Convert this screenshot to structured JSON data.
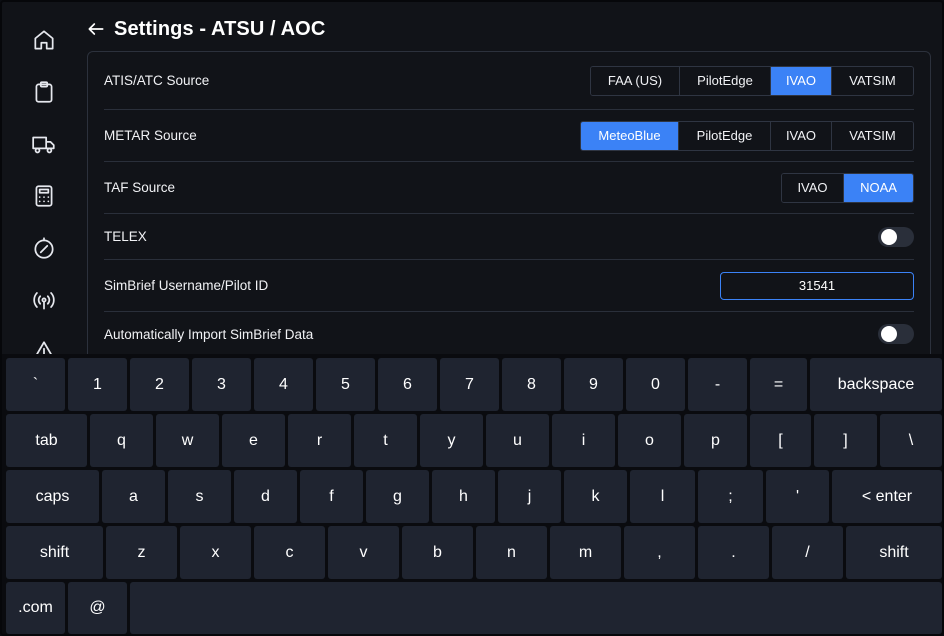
{
  "header": {
    "title": "Settings - ATSU / AOC"
  },
  "sidebar": {
    "items": [
      {
        "name": "home-icon"
      },
      {
        "name": "clipboard-icon"
      },
      {
        "name": "truck-icon"
      },
      {
        "name": "calculator-icon"
      },
      {
        "name": "compass-icon"
      },
      {
        "name": "broadcast-icon"
      },
      {
        "name": "warning-icon"
      }
    ]
  },
  "settings": {
    "atis": {
      "label": "ATIS/ATC Source",
      "options": [
        "FAA (US)",
        "PilotEdge",
        "IVAO",
        "VATSIM"
      ],
      "selected": "IVAO"
    },
    "metar": {
      "label": "METAR Source",
      "options": [
        "MeteoBlue",
        "PilotEdge",
        "IVAO",
        "VATSIM"
      ],
      "selected": "MeteoBlue"
    },
    "taf": {
      "label": "TAF Source",
      "options": [
        "IVAO",
        "NOAA"
      ],
      "selected": "NOAA"
    },
    "telex": {
      "label": "TELEX",
      "enabled": false
    },
    "simbrief": {
      "label": "SimBrief Username/Pilot ID",
      "value": "31541"
    },
    "auto_import": {
      "label": "Automatically Import SimBrief Data",
      "enabled": false
    }
  },
  "keyboard": {
    "row1": [
      "`",
      "1",
      "2",
      "3",
      "4",
      "5",
      "6",
      "7",
      "8",
      "9",
      "0",
      "-",
      "=",
      "backspace"
    ],
    "row2": [
      "tab",
      "q",
      "w",
      "e",
      "r",
      "t",
      "y",
      "u",
      "i",
      "o",
      "p",
      "[",
      "]",
      "\\"
    ],
    "row3": [
      "caps",
      "a",
      "s",
      "d",
      "f",
      "g",
      "h",
      "j",
      "k",
      "l",
      ";",
      "'",
      "< enter"
    ],
    "row4": [
      "shift",
      "z",
      "x",
      "c",
      "v",
      "b",
      "n",
      "m",
      ",",
      ".",
      "/",
      "shift"
    ],
    "row5": [
      ".com",
      "@",
      ""
    ]
  },
  "colors": {
    "accent": "#3b82f6",
    "background": "#111318",
    "key": "#1f2430"
  }
}
